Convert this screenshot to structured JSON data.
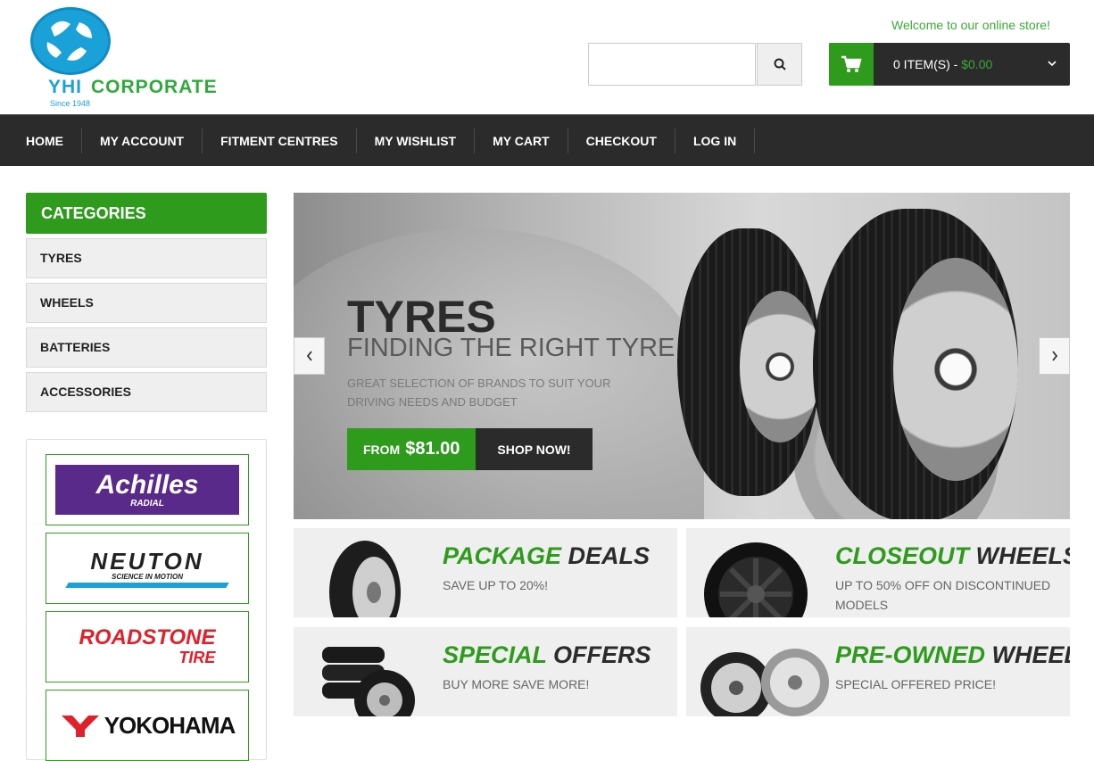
{
  "header": {
    "logo": {
      "brand1": "YHI",
      "brand2": "CORPORATE",
      "since": "Since 1948"
    },
    "welcome": "Welcome to our online store!",
    "search": {
      "placeholder": "",
      "button_icon": "search-icon"
    },
    "cart": {
      "items": "0 ITEM(S) - ",
      "total": "$0.00",
      "icon": "cart-icon"
    }
  },
  "nav": [
    "HOME",
    "MY ACCOUNT",
    "FITMENT CENTRES",
    "MY WISHLIST",
    "MY CART",
    "CHECKOUT",
    "LOG IN"
  ],
  "sidebar": {
    "categories_title": "CATEGORIES",
    "categories": [
      "TYRES",
      "WHEELS",
      "BATTERIES",
      "ACCESSORIES"
    ],
    "brands": [
      {
        "name": "Achilles",
        "sub": "RADIAL"
      },
      {
        "name": "NEUTON",
        "sub": "SCIENCE IN MOTION"
      },
      {
        "name": "ROADSTONE",
        "sub": "TIRE"
      },
      {
        "name": "YOKOHAMA",
        "sub": ""
      }
    ]
  },
  "slider": {
    "title": "TYRES",
    "subtitle": "FINDING THE RIGHT TYRE",
    "description": "GREAT SELECTION OF BRANDS TO SUIT YOUR DRIVING NEEDS AND BUDGET",
    "from_label": "FROM",
    "price": "$81.00",
    "shop_label": "SHOP NOW!"
  },
  "promos": [
    {
      "green": "PACKAGE",
      "dark": "DEALS",
      "desc": "SAVE UP TO 20%!"
    },
    {
      "green": "CLOSEOUT",
      "dark": "WHEELS",
      "desc": "UP TO 50% OFF ON DISCONTINUED MODELS"
    },
    {
      "green": "SPECIAL",
      "dark": "OFFERS",
      "desc": "BUY MORE SAVE MORE!"
    },
    {
      "green": "PRE-OWNED",
      "dark": "WHEELS",
      "desc": "SPECIAL OFFERED PRICE!"
    }
  ],
  "colors": {
    "green": "#2e9b1d",
    "dark": "#2b2b2b",
    "logo_blue": "#1aa1d8"
  }
}
